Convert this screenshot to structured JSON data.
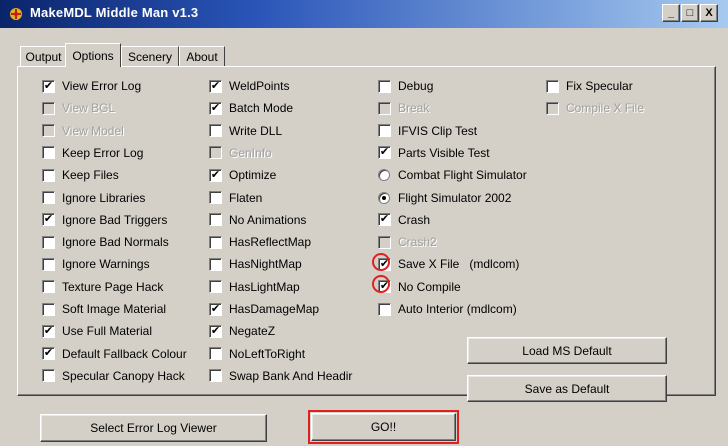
{
  "window": {
    "title": "MakeMDL Middle Man v1.3",
    "controls": {
      "minimize": "_",
      "maximize": "□",
      "close": "X"
    }
  },
  "tabs": [
    {
      "label": "Output",
      "active": false
    },
    {
      "label": "Options",
      "active": true
    },
    {
      "label": "Scenery",
      "active": false
    },
    {
      "label": "About",
      "active": false
    }
  ],
  "options": {
    "col1": [
      {
        "label": "View Error Log",
        "checked": true,
        "disabled": false
      },
      {
        "label": "View BGL",
        "checked": false,
        "disabled": true
      },
      {
        "label": "View Model",
        "checked": false,
        "disabled": true
      },
      {
        "label": "Keep Error Log",
        "checked": false,
        "disabled": false
      },
      {
        "label": "Keep Files",
        "checked": false,
        "disabled": false
      },
      {
        "label": "Ignore Libraries",
        "checked": false,
        "disabled": false
      },
      {
        "label": "Ignore Bad Triggers",
        "checked": true,
        "disabled": false
      },
      {
        "label": "Ignore Bad Normals",
        "checked": false,
        "disabled": false
      },
      {
        "label": "Ignore Warnings",
        "checked": false,
        "disabled": false
      },
      {
        "label": "Texture Page Hack",
        "checked": false,
        "disabled": false
      },
      {
        "label": "Soft Image Material",
        "checked": false,
        "disabled": false
      },
      {
        "label": "Use Full Material",
        "checked": true,
        "disabled": false
      },
      {
        "label": "Default Fallback Colour",
        "checked": true,
        "disabled": false
      },
      {
        "label": "Specular Canopy Hack",
        "checked": false,
        "disabled": false
      }
    ],
    "col2": [
      {
        "label": "WeldPoints",
        "checked": true,
        "disabled": false
      },
      {
        "label": "Batch Mode",
        "checked": true,
        "disabled": false
      },
      {
        "label": "Write DLL",
        "checked": false,
        "disabled": false
      },
      {
        "label": "GenInfo",
        "checked": false,
        "disabled": true
      },
      {
        "label": "Optimize",
        "checked": true,
        "disabled": false
      },
      {
        "label": "Flaten",
        "checked": false,
        "disabled": false
      },
      {
        "label": "No Animations",
        "checked": false,
        "disabled": false
      },
      {
        "label": "HasReflectMap",
        "checked": false,
        "disabled": false
      },
      {
        "label": "HasNightMap",
        "checked": false,
        "disabled": false
      },
      {
        "label": "HasLightMap",
        "checked": false,
        "disabled": false
      },
      {
        "label": "HasDamageMap",
        "checked": true,
        "disabled": false
      },
      {
        "label": "NegateZ",
        "checked": true,
        "disabled": false
      },
      {
        "label": "NoLeftToRight",
        "checked": false,
        "disabled": false
      },
      {
        "label": "Swap Bank And Headir",
        "checked": false,
        "disabled": false
      }
    ],
    "col3": [
      {
        "label": "Debug",
        "type": "checkbox",
        "checked": false,
        "disabled": false
      },
      {
        "label": "Break",
        "type": "checkbox",
        "checked": false,
        "disabled": true
      },
      {
        "label": "IFVIS Clip Test",
        "type": "checkbox",
        "checked": false,
        "disabled": false
      },
      {
        "label": "Parts Visible Test",
        "type": "checkbox",
        "checked": true,
        "disabled": false
      },
      {
        "label": "Combat Flight Simulator",
        "type": "radio",
        "checked": false,
        "disabled": false
      },
      {
        "label": "Flight Simulator 2002",
        "type": "radio",
        "checked": true,
        "disabled": false
      },
      {
        "label": "Crash",
        "type": "checkbox",
        "checked": true,
        "disabled": false
      },
      {
        "label": "Crash2",
        "type": "checkbox",
        "checked": false,
        "disabled": true
      },
      {
        "label": "Save X File   (mdlcom)",
        "type": "checkbox",
        "checked": true,
        "disabled": false,
        "highlight": true
      },
      {
        "label": "No Compile",
        "type": "checkbox",
        "checked": true,
        "disabled": false,
        "highlight": true
      },
      {
        "label": "Auto Interior (mdlcom)",
        "type": "checkbox",
        "checked": false,
        "disabled": false
      }
    ],
    "col4": [
      {
        "label": "Fix Specular",
        "checked": false,
        "disabled": false
      },
      {
        "label": "Compile X File",
        "checked": false,
        "disabled": true
      }
    ]
  },
  "buttons": {
    "load_ms_default": "Load MS Default",
    "save_as_default": "Save as Default",
    "select_error_log_viewer": "Select Error Log Viewer",
    "go": "GO!!"
  },
  "check_glyph": "✔",
  "colors": {
    "highlight": "#e02020",
    "title_start": "#0a246a",
    "title_end": "#a6caf0",
    "face": "#d4d0c8"
  }
}
